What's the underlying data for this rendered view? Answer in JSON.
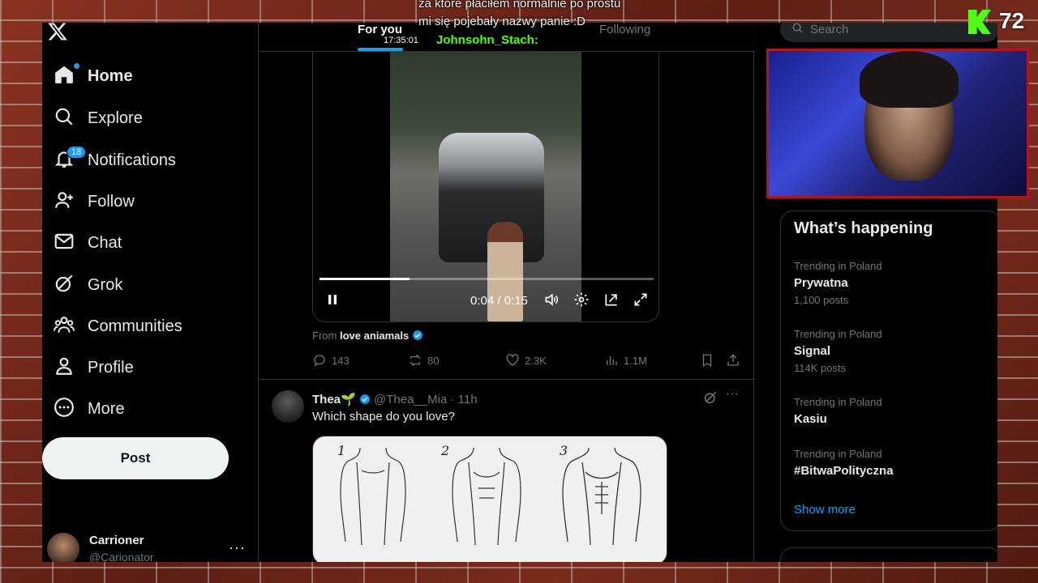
{
  "nav": {
    "home": "Home",
    "explore": "Explore",
    "notifications": "Notifications",
    "notifications_badge": "18",
    "follow": "Follow",
    "chat": "Chat",
    "grok": "Grok",
    "communities": "Communities",
    "profile": "Profile",
    "more": "More",
    "post_button": "Post"
  },
  "account": {
    "name": "Carrioner",
    "handle": "@Carionator",
    "more": "···"
  },
  "tabs": {
    "for_you": "For you",
    "following": "Following"
  },
  "video": {
    "time": "0:04 / 0:15",
    "progress": 0.27
  },
  "post1": {
    "from_label": "From",
    "from_name": "love aniamals",
    "replies": "143",
    "reposts": "80",
    "likes": "2.3K",
    "views": "1.1M"
  },
  "post2": {
    "name": "Thea🌱",
    "handle": "@Thea__Mia",
    "separator": "·",
    "time": "11h",
    "text": "Which shape do you love?",
    "more": "···",
    "figure_numbers": [
      "1",
      "2",
      "3"
    ]
  },
  "right": {
    "search_placeholder": "Search",
    "happening_title": "What’s happening",
    "trends": [
      {
        "context": "Trending in Poland",
        "name": "Prywatna",
        "count": "1,100 posts"
      },
      {
        "context": "Trending in Poland",
        "name": "Signal",
        "count": "114K posts"
      },
      {
        "context": "Trending in Poland",
        "name": "Kasiu",
        "count": ""
      },
      {
        "context": "Trending in Poland",
        "name": "#BitwaPolityczna",
        "count": ""
      }
    ],
    "show_more": "Show more"
  },
  "stream": {
    "chat_line1": "za które płaciłem normalnie po prostu",
    "chat_line2": "mi się pojebały nazwy panie :D",
    "chat_time": "17:35:01",
    "chat_user": "Johnsohn_Stach:",
    "viewer_count": "72"
  },
  "colors": {
    "accent": "#1d9bf0",
    "kick_green": "#53fc18",
    "cam_border": "#b0141c"
  }
}
